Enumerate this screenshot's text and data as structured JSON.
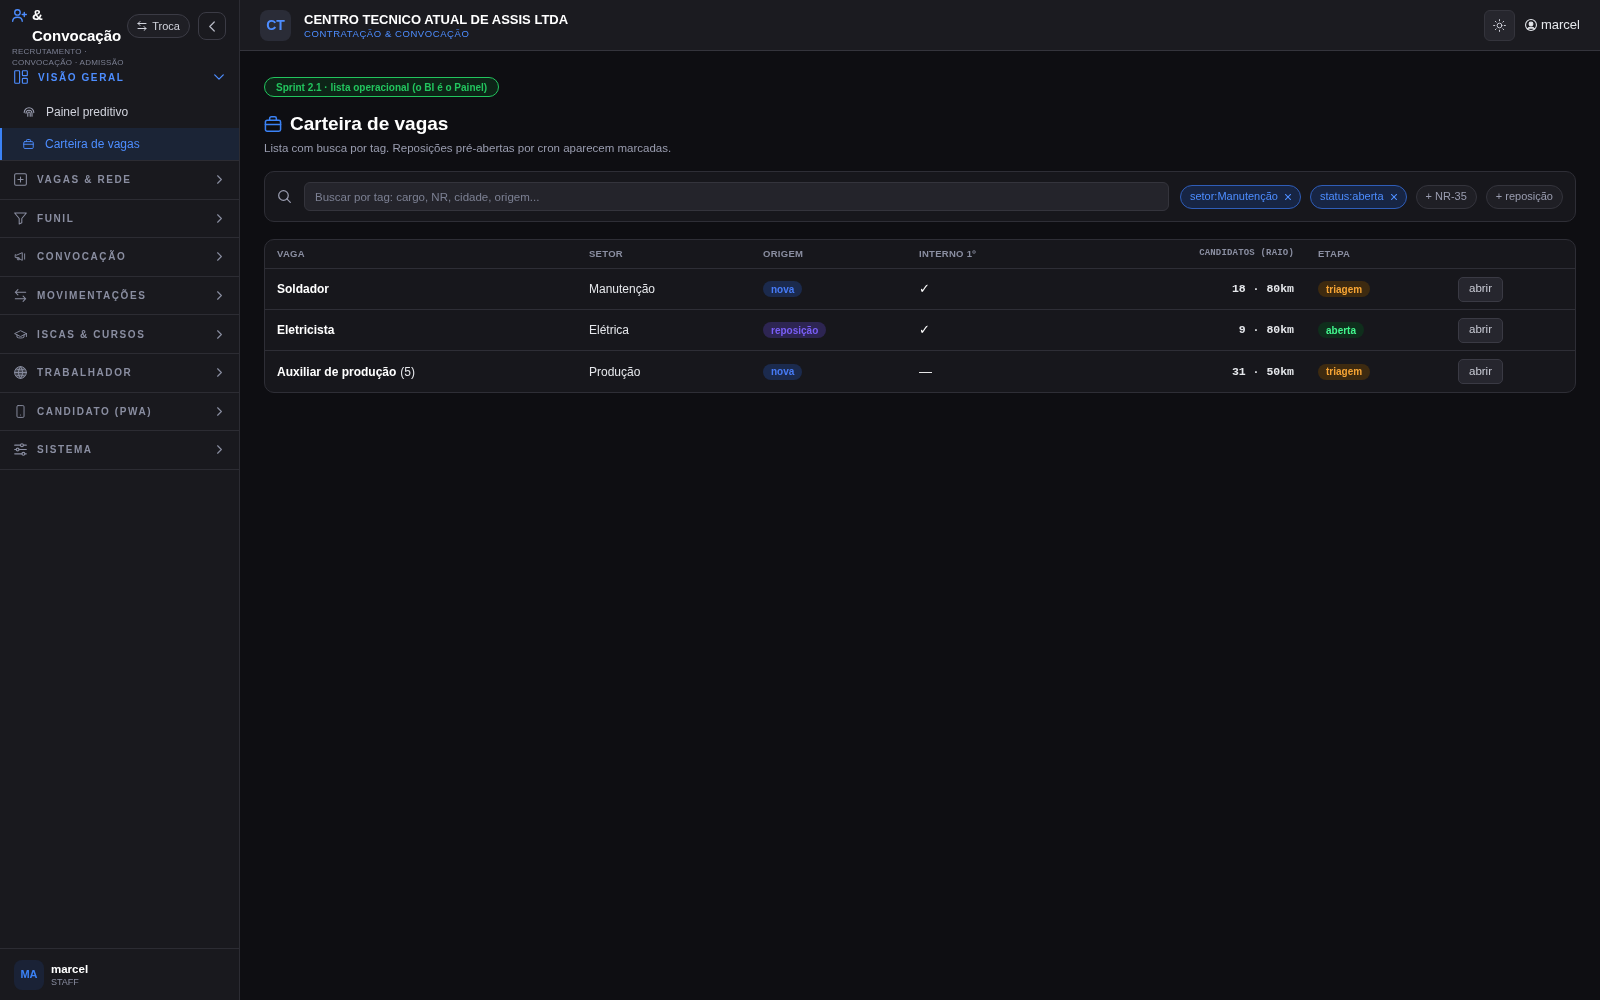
{
  "sidebar": {
    "app_title": "& Convocação",
    "app_subtitle": "RECRUTAMENTO · CONVOCAÇÃO · ADMISSÃO",
    "switch_button": "Troca",
    "sections": [
      {
        "label": "VISÃO GERAL",
        "expanded": true,
        "children": [
          {
            "label": "Painel preditivo",
            "selected": false
          },
          {
            "label": "Carteira de vagas",
            "selected": true
          }
        ]
      },
      {
        "label": "VAGAS & REDE",
        "expanded": false
      },
      {
        "label": "FUNIL",
        "expanded": false
      },
      {
        "label": "CONVOCAÇÃO",
        "expanded": false
      },
      {
        "label": "MOVIMENTAÇÕES",
        "expanded": false
      },
      {
        "label": "ISCAS & CURSOS",
        "expanded": false
      },
      {
        "label": "TRABALHADOR",
        "expanded": false
      },
      {
        "label": "CANDIDATO (PWA)",
        "expanded": false
      },
      {
        "label": "SISTEMA",
        "expanded": false
      }
    ],
    "user": {
      "initials": "MA",
      "name": "marcel",
      "role": "STAFF"
    }
  },
  "header": {
    "logo": "CT",
    "company": "CENTRO TECNICO ATUAL DE ASSIS LTDA",
    "module": "CONTRATAÇÃO & CONVOCAÇÃO",
    "user": "marcel"
  },
  "page": {
    "badge": "Sprint 2.1 · lista operacional (o BI é o Painel)",
    "title": "Carteira de vagas",
    "description": "Lista com busca por tag. Reposições pré-abertas por cron aparecem marcadas."
  },
  "filters": {
    "search": {
      "placeholder": "Buscar por tag: cargo, NR, cidade, origem..."
    },
    "chips": [
      {
        "label": "setor:Manutenção",
        "active": true
      },
      {
        "label": "status:aberta",
        "active": true
      },
      {
        "label": "+ NR-35",
        "active": false
      },
      {
        "label": "+ reposição",
        "active": false
      }
    ]
  },
  "table": {
    "columns": [
      "VAGA",
      "SETOR",
      "ORIGEM",
      "INTERNO 1º",
      "CANDIDATOS (RAIO)",
      "ETAPA"
    ],
    "rows": [
      {
        "vaga": "Soldador",
        "setor": "Manutenção",
        "origem": {
          "label": "nova",
          "color": "#1b2a4d"
        },
        "interno": "✓",
        "candidatos": "18 · 80km",
        "etapa": {
          "label": "triagem",
          "color": "#3d2a10"
        },
        "action": "abrir"
      },
      {
        "vaga": "Eletricista",
        "setor": "Elétrica",
        "origem": {
          "label": "reposição",
          "color": "#2d2552"
        },
        "interno": "✓",
        "candidatos": "9 · 80km",
        "etapa": {
          "label": "aberta",
          "color": "#0f2e1c"
        },
        "action": "abrir"
      },
      {
        "vaga": "Auxiliar de produção",
        "count": "(5)",
        "setor": "Produção",
        "origem": {
          "label": "nova",
          "color": "#1b2a4d"
        },
        "interno": "—",
        "candidatos": "31 · 50km",
        "etapa": {
          "label": "triagem",
          "color": "#3d2a10"
        },
        "action": "abrir"
      }
    ]
  }
}
